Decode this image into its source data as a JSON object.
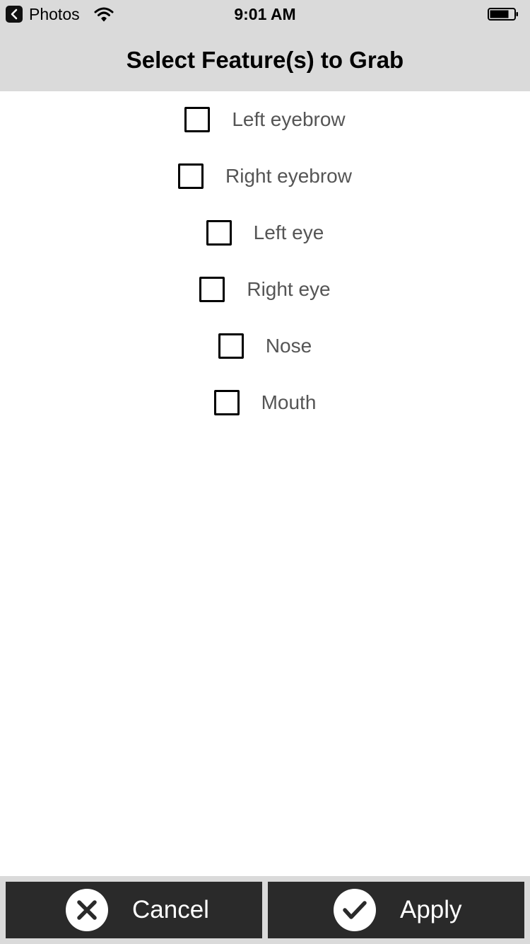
{
  "status_bar": {
    "back_app": "Photos",
    "time": "9:01 AM"
  },
  "header": {
    "title": "Select Feature(s) to Grab"
  },
  "features": [
    {
      "label": "Left eyebrow",
      "checked": false
    },
    {
      "label": "Right eyebrow",
      "checked": false
    },
    {
      "label": "Left eye",
      "checked": false
    },
    {
      "label": "Right eye",
      "checked": false
    },
    {
      "label": "Nose",
      "checked": false
    },
    {
      "label": "Mouth",
      "checked": false
    }
  ],
  "actions": {
    "cancel_label": "Cancel",
    "cancel_icon": "close-icon",
    "apply_label": "Apply",
    "apply_icon": "checkmark-icon"
  },
  "colors": {
    "bar_background": "#dadada",
    "button_background": "#2a2a2a",
    "label_text": "#555555"
  }
}
